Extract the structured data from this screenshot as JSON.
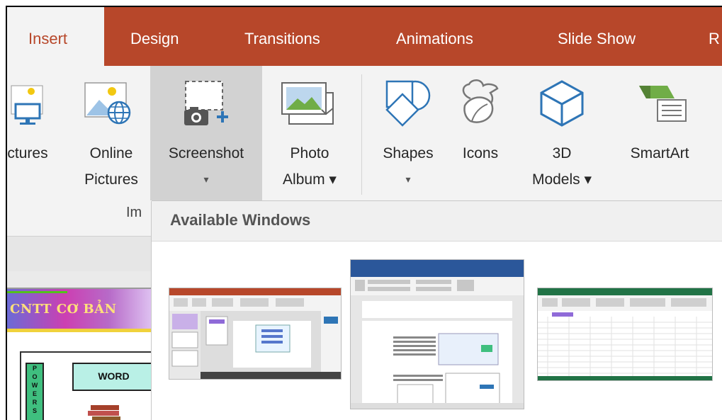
{
  "tabs": [
    {
      "label": "Insert",
      "active": true
    },
    {
      "label": "Design",
      "active": false
    },
    {
      "label": "Transitions",
      "active": false
    },
    {
      "label": "Animations",
      "active": false
    },
    {
      "label": "Slide Show",
      "active": false
    },
    {
      "label": "R",
      "active": false
    }
  ],
  "ribbon": {
    "pictures": {
      "line1": "ctures",
      "line2": ""
    },
    "online_pictures": {
      "line1": "Online",
      "line2": "Pictures"
    },
    "screenshot": {
      "line1": "Screenshot",
      "line2": "▾"
    },
    "photo_album": {
      "line1": "Photo",
      "line2": "Album ▾"
    },
    "shapes": {
      "line1": "Shapes",
      "line2": "▾"
    },
    "icons": {
      "line1": "Icons",
      "line2": ""
    },
    "models_3d": {
      "line1": "3D",
      "line2": "Models ▾"
    },
    "smartart": {
      "line1": "SmartArt",
      "line2": ""
    },
    "images_group_label": "Im"
  },
  "slide_thumb": {
    "title": "CNTT CƠ BẢN",
    "side_letters": [
      "P",
      "O",
      "W",
      "E",
      "R",
      "S"
    ],
    "word_label": "WORD"
  },
  "dropdown": {
    "title": "Available Windows",
    "windows": [
      {
        "app": "PowerPoint",
        "accent": "#b7472a"
      },
      {
        "app": "Word",
        "accent": "#2b579a"
      },
      {
        "app": "Excel",
        "accent": "#217346"
      }
    ]
  },
  "colors": {
    "ppt_accent": "#b7472a",
    "word_accent": "#2b579a",
    "excel_accent": "#217346",
    "icon_blue": "#2e75b6"
  }
}
